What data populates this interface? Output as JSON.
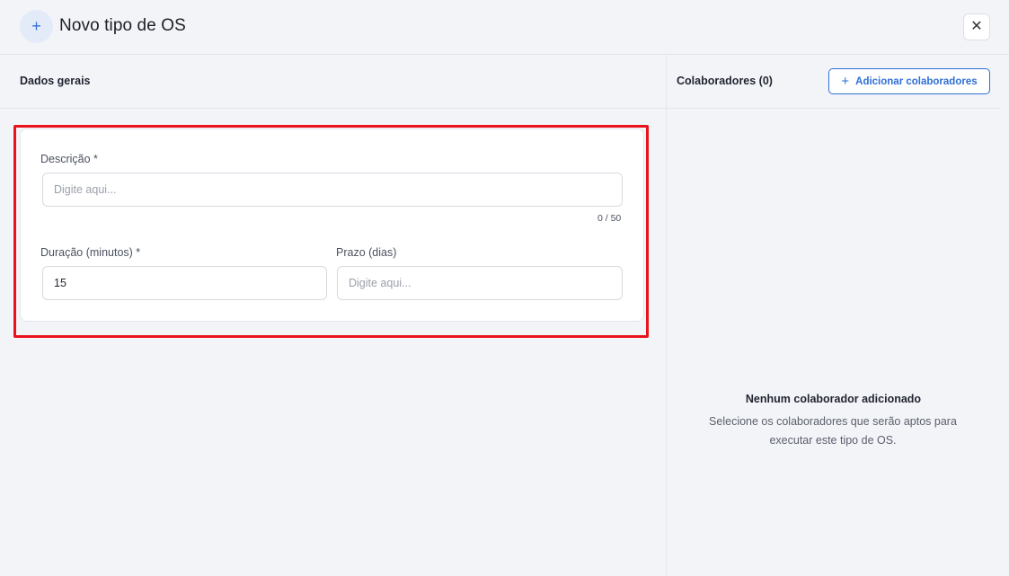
{
  "header": {
    "title": "Novo tipo de OS",
    "icon": "plus-icon",
    "close_icon": "close-icon",
    "icon_glyph": "+",
    "close_glyph": "✕"
  },
  "left_panel": {
    "title": "Dados gerais"
  },
  "form": {
    "descricao_label": "Descrição *",
    "descricao_placeholder": "Digite aqui...",
    "descricao_counter": "0 / 50",
    "duracao_label": "Duração (minutos) *",
    "duracao_value": "15",
    "prazo_label": "Prazo (dias)",
    "prazo_placeholder": "Digite aqui..."
  },
  "right_panel": {
    "title": "Colaboradores (0)",
    "add_button_label": "Adicionar colaboradores",
    "add_button_icon": "plus-icon",
    "add_button_glyph": "+",
    "empty_title": "Nenhum colaborador adicionado",
    "empty_description": "Selecione os colaboradores que serão aptos para executar este tipo de OS."
  },
  "colors": {
    "accent": "#2f6fd6",
    "highlight": "#e8131b",
    "background": "#f3f4f8"
  }
}
